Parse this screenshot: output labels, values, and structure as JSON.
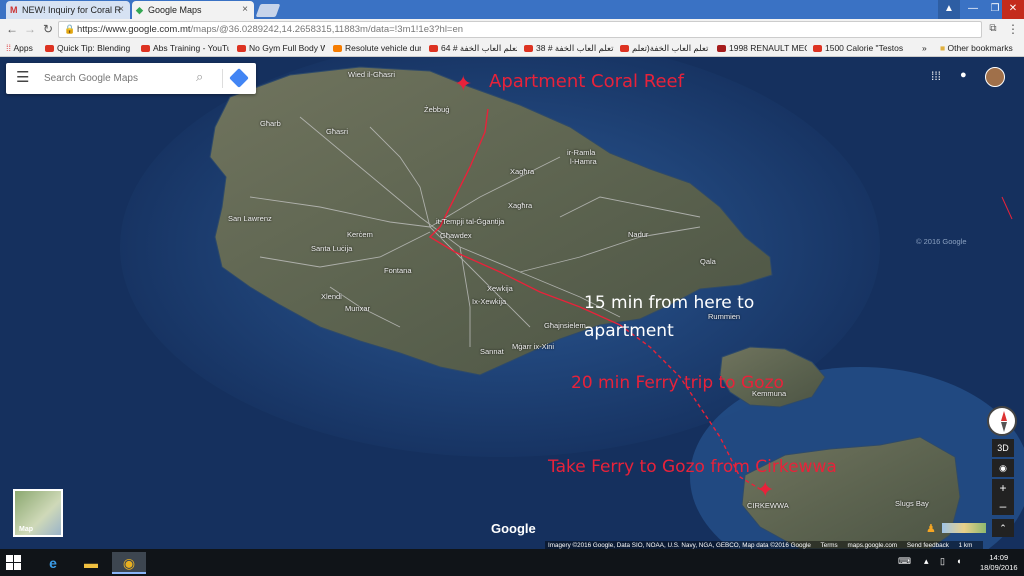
{
  "browser": {
    "tabs": [
      {
        "label": "NEW! Inquiry for Coral R",
        "icon": "gmail-icon",
        "close": "×"
      },
      {
        "label": "Google Maps",
        "icon": "google-maps-icon",
        "close": "×"
      }
    ],
    "url_host": "https://www.google.com.mt",
    "url_path": "/maps/@36.0289242,14.2658315,11883m/data=!3m1!1e3?hl=en",
    "bookmarks": [
      {
        "label": "Apps"
      },
      {
        "label": "Quick Tip: Blending S"
      },
      {
        "label": "Abs Training - YouTu"
      },
      {
        "label": "No Gym Full Body W"
      },
      {
        "label": "Resolute vehicle dum"
      },
      {
        "label": "تعلم العاب الخفة # 64"
      },
      {
        "label": "تعلم العاب الخفة # 38"
      },
      {
        "label": "تعلم العاب الخفة(تعلم"
      },
      {
        "label": "1998 RENAULT MEGA"
      },
      {
        "label": "1500 Calorie \"Testost"
      }
    ],
    "overflow": "»",
    "other_bookmarks": "Other bookmarks"
  },
  "maps": {
    "search_placeholder": "Search Google Maps",
    "minimap_label": "Map",
    "logo": "Google",
    "ctl_3d": "3D",
    "zoom_in": "+",
    "zoom_out": "–",
    "attribution": "Imagery ©2016 Google, Data SIO, NOAA, U.S. Navy, NGA, GEBCO, Map data ©2016 Google",
    "terms": "Terms",
    "site": "maps.google.com",
    "feedback": "Send feedback",
    "scale": "1 km",
    "watermark": "© 2016 Google"
  },
  "place_labels": {
    "wied_il_ghasri": "Wied il-Għasri",
    "zebbug": "Żebbuġ",
    "gharb": "Għarb",
    "ghasri": "Għasri",
    "ir_ramla": "ir-Ramla",
    "l_hamra": "l-Hamra",
    "xaghra1": "Xagħra",
    "xaghra2": "Xagħra",
    "san_lawrenz": "San Lawrenz",
    "kercem": "Kerċem",
    "tempji": "it-Tempji tal-Ġgantija",
    "ghawdex": "Għawdex",
    "nadur": "Nadur",
    "santa_lucija": "Santa Luċija",
    "fontana": "Fontana",
    "qala": "Qala",
    "xlendi": "Xlendi",
    "munxar": "Munxar",
    "xewkija": "Xewkija",
    "ix_xewkija": "Ix-Xewkija",
    "ghajnsielem": "Għajnsielem",
    "mgarr": "Mġarr ix-Xini",
    "sannat": "Sannat",
    "rummien": "Rummien",
    "kemmuna": "Kemmuna",
    "cirkewwa": "ĊIRKEWWA",
    "slugs_bay": "Slugs Bay"
  },
  "annotations": {
    "apartment": "Apartment Coral Reef",
    "fifteen_line1": "15 min from here to",
    "fifteen_line2": "apartment",
    "ferry_trip": "20 min Ferry trip to Gozo",
    "take_ferry": "Take Ferry to Gozo from Cirkewwa"
  },
  "taskbar": {
    "time": "14:09",
    "date": "18/09/2016"
  },
  "colors": {
    "annotation_red": "#e8223a",
    "annotation_white": "#ffffff",
    "tab_bar": "#3a72c4",
    "sea": "#15305e"
  }
}
